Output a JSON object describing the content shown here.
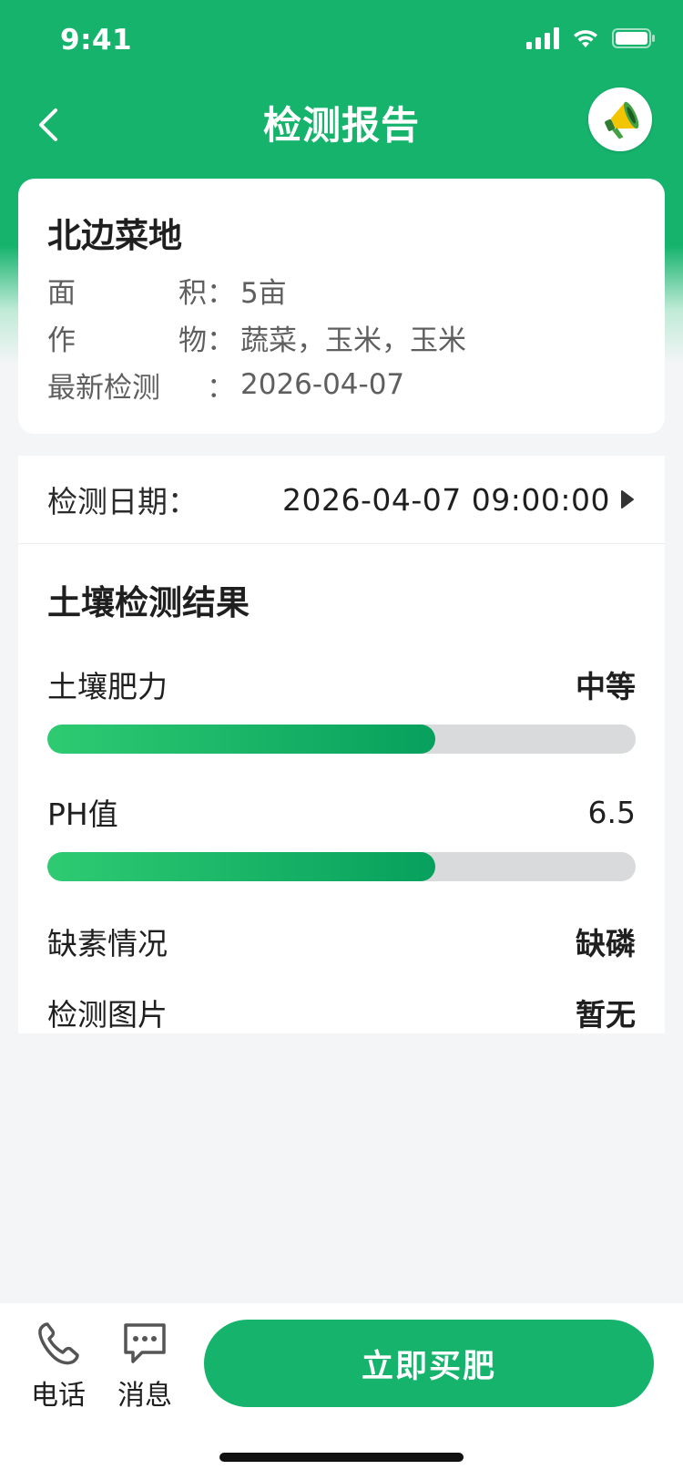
{
  "status_bar": {
    "time": "9:41"
  },
  "navbar": {
    "title": "检测报告",
    "back_icon": "chevron-left-icon",
    "action_icon": "megaphone-icon"
  },
  "field": {
    "name": "北边菜地",
    "area_label_1": "面",
    "area_label_2": "积",
    "area_value": "5亩",
    "crop_label_1": "作",
    "crop_label_2": "物",
    "crop_value": "蔬菜，玉米，玉米",
    "latest_label": "最新检测",
    "latest_value": "2026-04-07",
    "colon": "："
  },
  "report": {
    "date_label": "检测日期：",
    "date_value": "2026-04-07 09:00:00",
    "results_title": "土壤检测结果",
    "fertility_label": "土壤肥力",
    "fertility_value": "中等",
    "fertility_percent": 66,
    "ph_label": "PH值",
    "ph_value": "6.5",
    "ph_percent": 66,
    "deficiency_label": "缺素情况",
    "deficiency_value": "缺磷",
    "image_label": "检测图片",
    "image_value": "暂无"
  },
  "bottom_bar": {
    "phone_label": "电话",
    "message_label": "消息",
    "buy_label": "立即买肥"
  },
  "colors": {
    "primary": "#16b36d",
    "bar_start": "#2ecb72",
    "bar_end": "#07a05d",
    "track": "#d9dadc"
  }
}
